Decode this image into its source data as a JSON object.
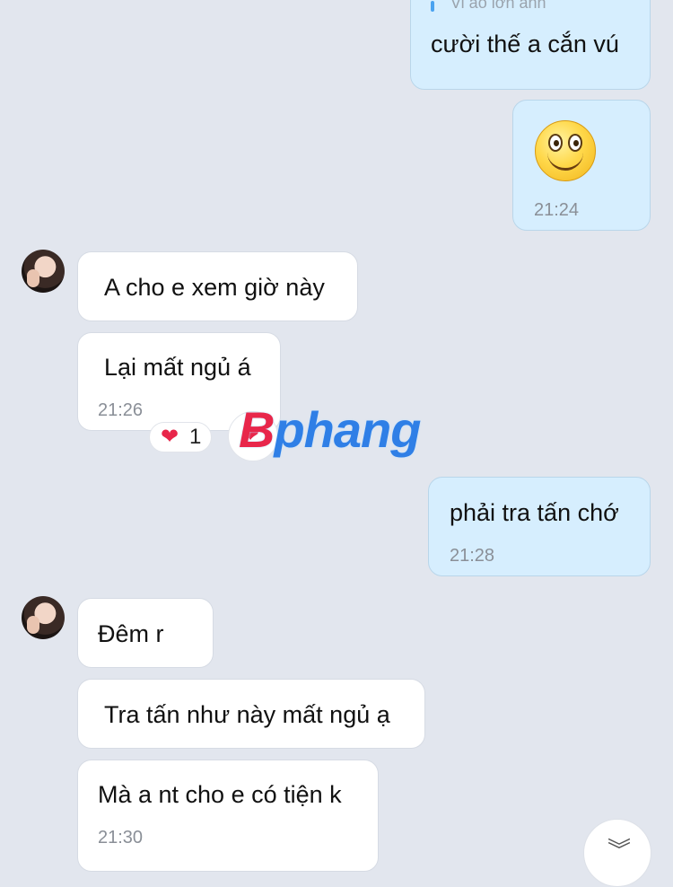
{
  "messages": [
    {
      "id": "m1",
      "side": "out",
      "quote": "Vi ảo lớn anh",
      "text": "cười thế a cắn vú"
    },
    {
      "id": "m2",
      "side": "out",
      "sticker": "smiley-sticker",
      "time": "21:24"
    },
    {
      "id": "m3",
      "side": "in",
      "text": "A cho e xem giờ này"
    },
    {
      "id": "m4",
      "side": "in",
      "text": "Lại mất ngủ á",
      "time": "21:26",
      "reaction": {
        "icon": "heart-icon",
        "emoji": "❤",
        "count": "1"
      }
    },
    {
      "id": "m5",
      "side": "out",
      "text": "phải tra tấn chớ",
      "time": "21:28"
    },
    {
      "id": "m6",
      "side": "in",
      "text": "Đêm r"
    },
    {
      "id": "m7",
      "side": "in",
      "text": "Tra tấn như này mất ngủ ạ"
    },
    {
      "id": "m8",
      "side": "in",
      "text": "Mà a nt cho e có tiện k",
      "time": "21:30"
    }
  ],
  "watermark": {
    "prefix": "B",
    "text": "phang"
  },
  "scroll_button": {
    "glyph": "︾"
  },
  "colors": {
    "background": "#e2e6ee",
    "incoming": "#ffffff",
    "outgoing": "#d6eefe",
    "heart": "#e8264a",
    "watermark": "#2f7fe6"
  }
}
